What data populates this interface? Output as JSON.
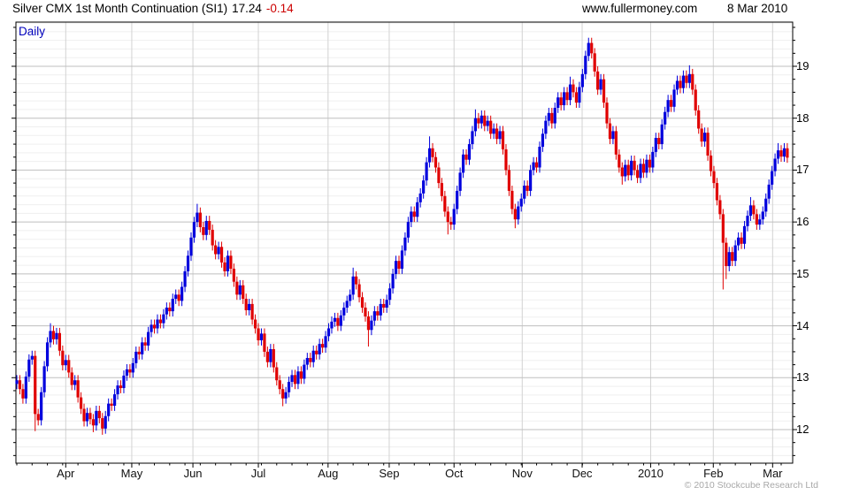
{
  "header": {
    "instrument": "Silver CMX 1st Month Continuation (SI1)",
    "price": "17.24",
    "change": "-0.14",
    "site": "www.fullermoney.com",
    "date": "8 Mar 2010"
  },
  "chart": {
    "timeframe_label": "Daily",
    "copyright": "© 2010 Stockcube Research Ltd"
  },
  "chart_data": {
    "type": "candlestick",
    "title": "Silver CMX 1st Month Continuation (SI1)",
    "subtitle": "Daily",
    "last_close": 17.24,
    "change": -0.14,
    "x_axis": {
      "tick_labels": [
        "Apr",
        "May",
        "Jun",
        "Jul",
        "Aug",
        "Sep",
        "Oct",
        "Nov",
        "Dec",
        "2010",
        "Feb",
        "Mar"
      ],
      "tick_day_index": [
        16,
        37.6,
        57.6,
        79,
        101.8,
        121.8,
        143,
        165.3,
        184.9,
        207.3,
        227.8,
        247.2
      ]
    },
    "y_axis": {
      "ticks": [
        12,
        13,
        14,
        15,
        16,
        17,
        18,
        19
      ],
      "minor_tick_step": 0.25,
      "range": [
        11.35,
        19.85
      ],
      "side": "right",
      "grid": true
    },
    "first_open": 12.88,
    "wick_pad": 0.1,
    "closes": [
      12.95,
      12.78,
      12.6,
      13.02,
      13.35,
      13.42,
      12.3,
      12.18,
      12.72,
      13.22,
      13.68,
      13.9,
      13.74,
      13.86,
      13.52,
      13.24,
      13.34,
      13.1,
      12.86,
      12.95,
      12.62,
      12.4,
      12.16,
      12.32,
      12.2,
      12.08,
      12.36,
      12.22,
      12.02,
      12.26,
      12.5,
      12.46,
      12.68,
      12.85,
      12.8,
      13.04,
      13.16,
      13.1,
      13.28,
      13.5,
      13.45,
      13.68,
      13.62,
      13.88,
      14.02,
      13.95,
      14.12,
      14.05,
      14.22,
      14.35,
      14.28,
      14.52,
      14.6,
      14.48,
      14.75,
      15.05,
      15.35,
      15.7,
      16.0,
      16.18,
      15.9,
      15.75,
      16.02,
      15.85,
      15.55,
      15.38,
      15.52,
      15.22,
      15.05,
      15.35,
      15.1,
      14.85,
      14.6,
      14.78,
      14.52,
      14.3,
      14.42,
      14.12,
      13.95,
      13.72,
      13.85,
      13.5,
      13.3,
      13.55,
      13.2,
      12.95,
      12.78,
      12.6,
      12.72,
      12.92,
      13.05,
      12.88,
      13.12,
      12.98,
      13.25,
      13.38,
      13.3,
      13.52,
      13.45,
      13.65,
      13.58,
      13.8,
      13.95,
      14.08,
      14.15,
      14.0,
      14.2,
      14.35,
      14.48,
      14.6,
      14.95,
      14.8,
      14.55,
      14.35,
      14.18,
      13.92,
      14.1,
      14.28,
      14.2,
      14.42,
      14.35,
      14.5,
      14.72,
      15.0,
      15.25,
      15.1,
      15.45,
      15.7,
      16.0,
      16.2,
      16.1,
      16.38,
      16.55,
      16.8,
      17.15,
      17.42,
      17.25,
      17.05,
      16.75,
      16.5,
      16.2,
      16.0,
      15.95,
      16.25,
      16.6,
      16.95,
      17.3,
      17.2,
      17.5,
      17.75,
      18.0,
      17.9,
      18.05,
      17.85,
      17.95,
      17.7,
      17.8,
      17.6,
      17.75,
      17.4,
      17.0,
      16.6,
      16.25,
      16.05,
      16.3,
      16.45,
      16.7,
      16.6,
      17.0,
      17.15,
      17.05,
      17.45,
      17.7,
      17.95,
      18.1,
      17.9,
      18.2,
      18.4,
      18.25,
      18.5,
      18.35,
      18.65,
      18.5,
      18.3,
      18.6,
      18.85,
      19.2,
      19.45,
      19.25,
      18.9,
      18.55,
      18.75,
      18.3,
      17.9,
      17.6,
      17.75,
      17.3,
      17.05,
      16.88,
      17.1,
      16.9,
      17.18,
      17.0,
      16.85,
      17.12,
      16.95,
      17.2,
      17.05,
      17.35,
      17.62,
      17.5,
      17.88,
      18.12,
      18.35,
      18.22,
      18.55,
      18.72,
      18.58,
      18.82,
      18.68,
      18.85,
      18.55,
      18.15,
      17.8,
      17.55,
      17.72,
      17.28,
      16.98,
      16.75,
      16.42,
      16.15,
      15.6,
      15.15,
      15.42,
      15.25,
      15.55,
      15.7,
      15.58,
      15.92,
      16.12,
      16.32,
      16.15,
      15.95,
      16.05,
      16.2,
      16.45,
      16.72,
      16.98,
      17.22,
      17.38,
      17.26,
      17.42,
      17.24
    ],
    "high_overrides": {
      "11": 14.05,
      "59": 16.35,
      "110": 15.12,
      "135": 17.65,
      "150": 18.17,
      "181": 18.8,
      "187": 19.55,
      "220": 19.02,
      "240": 16.48,
      "249": 17.52
    },
    "low_overrides": {
      "6": 11.97,
      "25": 11.95,
      "28": 11.9,
      "87": 12.45,
      "115": 13.6,
      "141": 15.76,
      "163": 15.88,
      "198": 16.72,
      "231": 14.7,
      "232": 14.9
    },
    "colors": {
      "up": "#0000dd",
      "down": "#e00000",
      "grid_major": "#bfbfbf",
      "grid_minor": "#efefef",
      "grid_month": "#d2d2d2",
      "axis": "#000000",
      "daily_label": "#0000bb",
      "change_text": "#cc0000",
      "copyright": "#a8a8a8"
    },
    "legend_position": "none"
  }
}
